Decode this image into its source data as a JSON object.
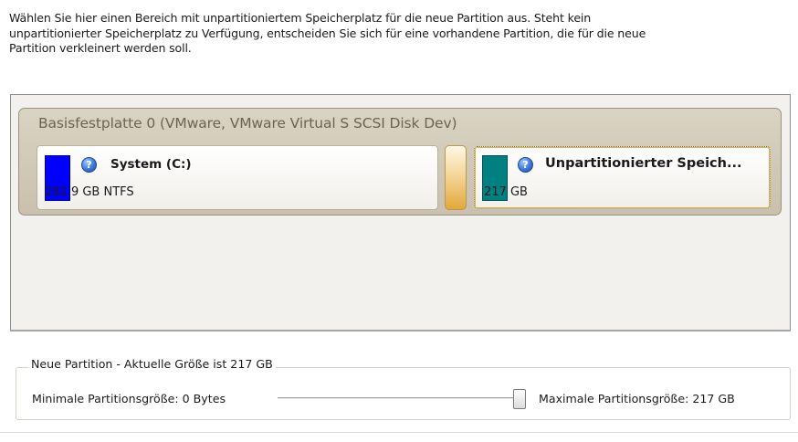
{
  "instructions": {
    "line1": "Wählen Sie hier einen Bereich mit unpartitioniertem Speicherplatz für die neue Partition aus. Steht kein",
    "line2": "unpartitionierter Speicherplatz zu Verfügung, entscheiden Sie sich für eine vorhandene Partition, die für die neue",
    "line3": "Partition verkleinert werden soll."
  },
  "disk": {
    "title": "Basisfestplatte 0 (VMware, VMware Virtual S SCSI Disk Dev)",
    "partitions": [
      {
        "name": "System (C:)",
        "size": "282.9 GB NTFS",
        "color": "#0000ff",
        "icon": "help-icon",
        "selected": false
      },
      {
        "name": "Unpartitionierter Speich...",
        "size": "217 GB",
        "color": "#008080",
        "icon": "help-icon",
        "selected": true
      }
    ]
  },
  "new_partition": {
    "legend": "Neue Partition - Aktuelle Größe ist 217 GB",
    "min_label": "Minimale Partitionsgröße:  0 Bytes",
    "max_label": "Maximale Partitionsgröße:  217 GB",
    "slider_value_fraction": 1.0
  }
}
